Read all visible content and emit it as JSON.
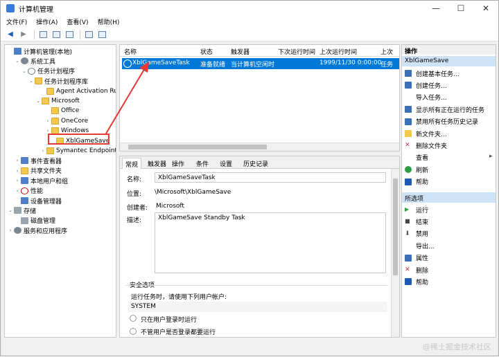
{
  "window": {
    "title": "计算机管理",
    "min": "—",
    "max": "☐",
    "close": "✕"
  },
  "menu": [
    "文件(F)",
    "操作(A)",
    "查看(V)",
    "帮助(H)"
  ],
  "tree": [
    {
      "label": "计算机管理(本地)",
      "exp": "",
      "icon": "computer"
    },
    {
      "label": "系统工具",
      "exp": "⌄",
      "icon": "gear"
    },
    {
      "label": "任务计划程序",
      "exp": "⌄",
      "icon": "clock"
    },
    {
      "label": "任务计划程序库",
      "exp": "⌄",
      "icon": "folder"
    },
    {
      "label": "Agent Activation Runt",
      "exp": "",
      "icon": "folder"
    },
    {
      "label": "Microsoft",
      "exp": "⌄",
      "icon": "folder"
    },
    {
      "label": "Office",
      "exp": "",
      "icon": "folder"
    },
    {
      "label": "OneCore",
      "exp": "›",
      "icon": "folder"
    },
    {
      "label": "Windows",
      "exp": "›",
      "icon": "folder"
    },
    {
      "label": "XblGameSave",
      "exp": "",
      "icon": "folder"
    },
    {
      "label": "Symantec Endpoint P",
      "exp": "›",
      "icon": "folder"
    },
    {
      "label": "事件查看器",
      "exp": "›",
      "icon": "blue"
    },
    {
      "label": "共享文件夹",
      "exp": "›",
      "icon": "folder"
    },
    {
      "label": "本地用户和组",
      "exp": "›",
      "icon": "blue"
    },
    {
      "label": "性能",
      "exp": "›",
      "icon": "red"
    },
    {
      "label": "设备管理器",
      "exp": "",
      "icon": "blue"
    },
    {
      "label": "存储",
      "exp": "⌄",
      "icon": "disk"
    },
    {
      "label": "磁盘管理",
      "exp": "",
      "icon": "disk"
    },
    {
      "label": "服务和应用程序",
      "exp": "›",
      "icon": "gear"
    }
  ],
  "list": {
    "headers": [
      "名称",
      "状态",
      "触发器",
      "下次运行时间",
      "上次运行时间",
      "上次"
    ],
    "row": [
      "XblGameSaveTask",
      "准备就绪",
      "当计算机空闲时",
      "",
      "1999/11/30 0:00:00",
      "任务"
    ]
  },
  "detail": {
    "tabs": [
      "常规",
      "触发器",
      "操作",
      "条件",
      "设置",
      "历史记录"
    ],
    "name_label": "名称:",
    "name_value": "XblGameSaveTask",
    "loc_label": "位置:",
    "loc_value": "\\Microsoft\\XblGameSave",
    "author_label": "创建者:",
    "author_value": "Microsoft",
    "desc_label": "描述:",
    "desc_value": "XblGameSave Standby Task",
    "security_title": "安全选项",
    "security_text": "运行任务时，请使用下列用户帐户:",
    "security_user": "SYSTEM",
    "opt1": "只在用户登录时运行",
    "opt2": "不管用户是否登录都要运行"
  },
  "actions": {
    "header": "操作",
    "section1": "XblGameSave",
    "items1": [
      {
        "label": "创建基本任务...",
        "icon": "blue"
      },
      {
        "label": "创建任务...",
        "icon": "blue"
      },
      {
        "label": "导入任务...",
        "icon": ""
      },
      {
        "label": "显示所有正在运行的任务",
        "icon": "blue"
      },
      {
        "label": "禁用所有任务历史记录",
        "icon": "blue"
      },
      {
        "label": "新文件夹...",
        "icon": "folder"
      },
      {
        "label": "删除文件夹",
        "icon": "x"
      },
      {
        "label": "查看",
        "icon": ""
      },
      {
        "label": "刷新",
        "icon": "green"
      },
      {
        "label": "帮助",
        "icon": "help"
      }
    ],
    "section2": "所选项",
    "items2": [
      {
        "label": "运行",
        "icon": "play"
      },
      {
        "label": "结束",
        "icon": "stop"
      },
      {
        "label": "禁用",
        "icon": "down"
      },
      {
        "label": "导出...",
        "icon": ""
      },
      {
        "label": "属性",
        "icon": "blue"
      },
      {
        "label": "删除",
        "icon": "x"
      },
      {
        "label": "帮助",
        "icon": "help"
      }
    ]
  },
  "watermark": "@稀土掘金技术社区"
}
